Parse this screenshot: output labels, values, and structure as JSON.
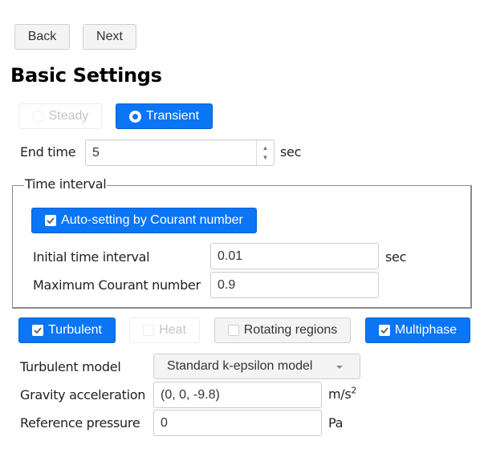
{
  "nav": {
    "back_label": "Back",
    "next_label": "Next"
  },
  "page_title": "Basic Settings",
  "mode": {
    "steady_label": "Steady",
    "steady_enabled": false,
    "transient_label": "Transient",
    "selected": "Transient"
  },
  "end_time": {
    "label": "End time",
    "value": "5",
    "unit": "sec"
  },
  "time_interval": {
    "legend": "Time interval",
    "auto_setting_label": "Auto-setting by Courant number",
    "auto_setting_checked": true,
    "initial_interval": {
      "label": "Initial time interval",
      "value": "0.01",
      "unit": "sec"
    },
    "max_courant": {
      "label": "Maximum Courant number",
      "value": "0.9"
    }
  },
  "options": [
    {
      "label": "Turbulent",
      "checked": true,
      "enabled": true
    },
    {
      "label": "Heat",
      "checked": false,
      "enabled": false
    },
    {
      "label": "Rotating regions",
      "checked": false,
      "enabled": true
    },
    {
      "label": "Multiphase",
      "checked": true,
      "enabled": true
    }
  ],
  "turbulent_model": {
    "label": "Turbulent model",
    "selected": "Standard k-epsilon model"
  },
  "gravity": {
    "label": "Gravity acceleration",
    "value": "(0, 0, -9.8)",
    "unit_base": "m/s",
    "unit_exp": "2"
  },
  "reference_pressure": {
    "label": "Reference pressure",
    "value": "0",
    "unit": "Pa"
  },
  "colors": {
    "accent": "#0a75f5",
    "button_gray": "#f4f4f4",
    "disabled_text": "#c4c4c4"
  }
}
